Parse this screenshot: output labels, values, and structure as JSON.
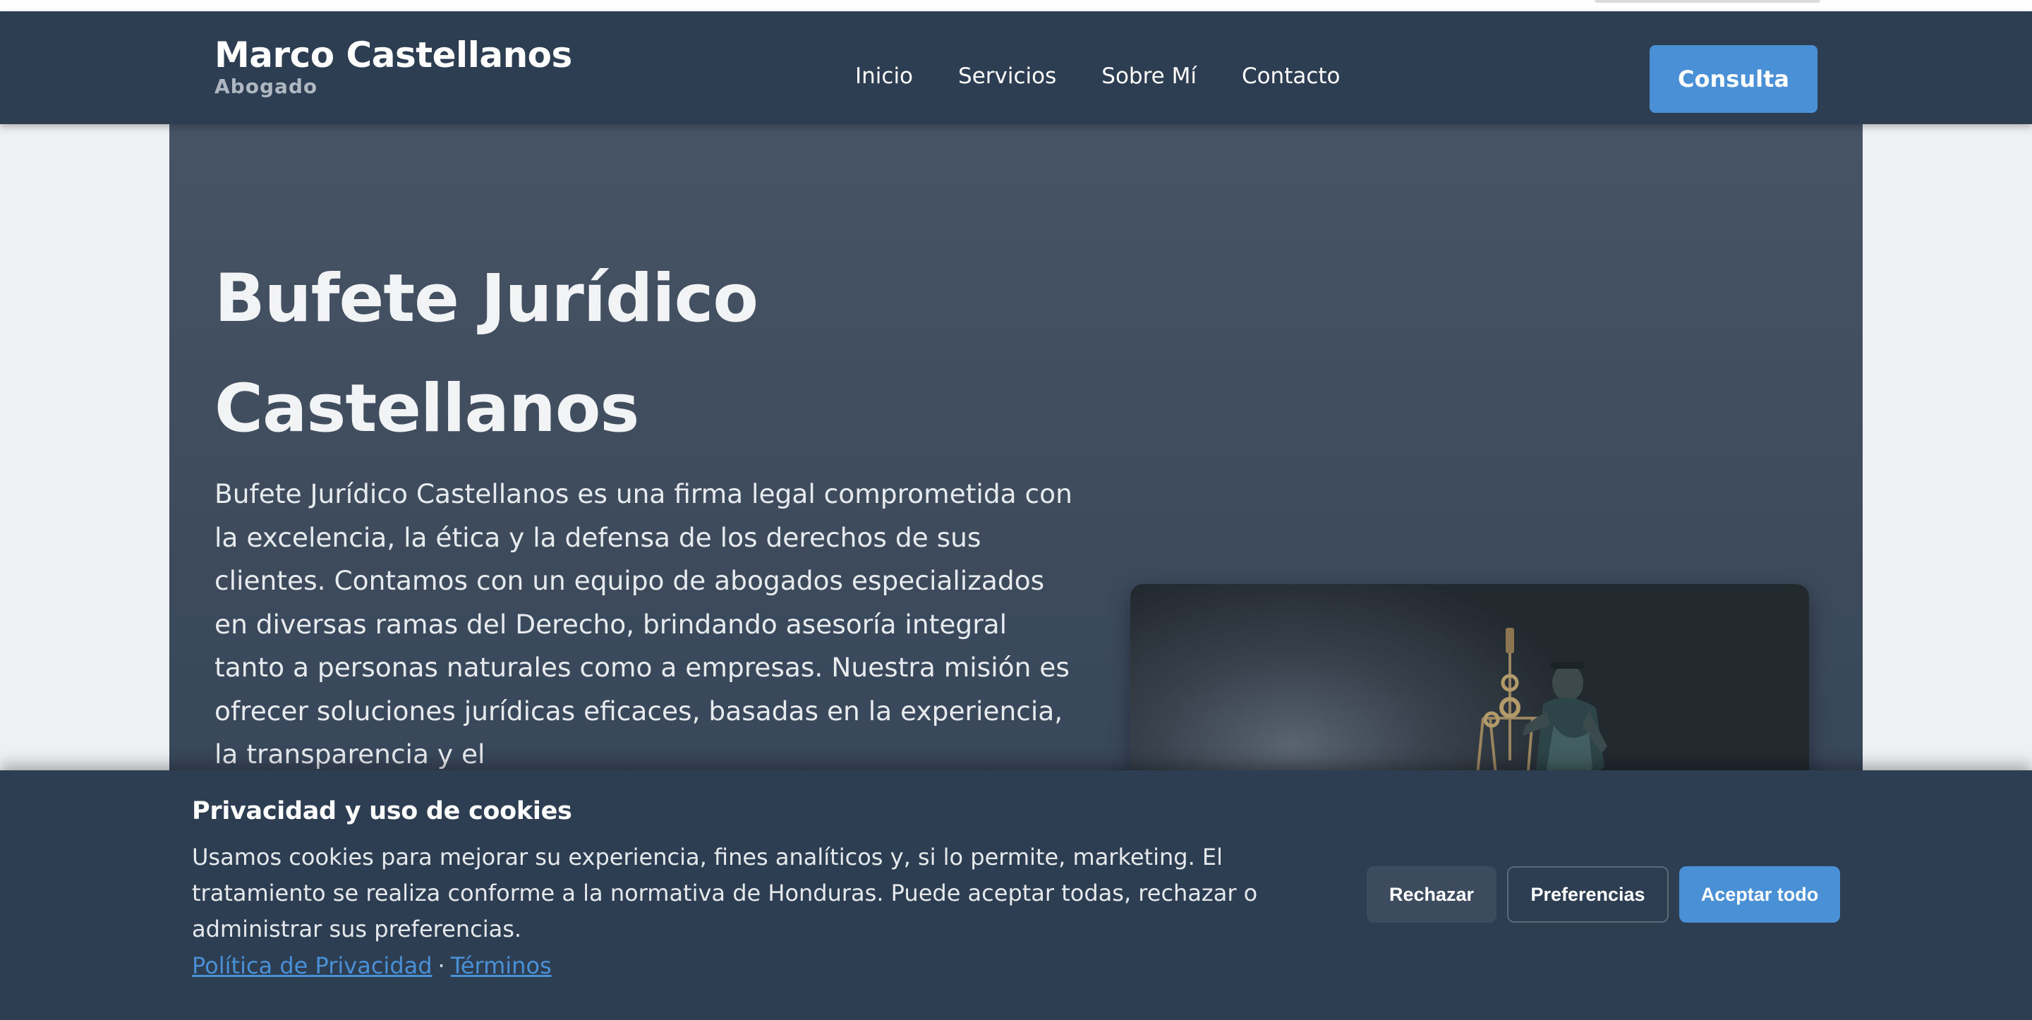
{
  "header": {
    "brand_name": "Marco Castellanos",
    "brand_subtitle": "Abogado",
    "nav": [
      {
        "label": "Inicio"
      },
      {
        "label": "Servicios"
      },
      {
        "label": "Sobre Mí"
      },
      {
        "label": "Contacto"
      }
    ],
    "cta_label": "Consulta"
  },
  "hero": {
    "title": "Bufete Jurídico Castellanos",
    "description": "Bufete Jurídico Castellanos es una firma legal comprometida con la excelencia, la ética y la defensa de los derechos de sus clientes. Contamos con un equipo de abogados especializados en diversas ramas del Derecho, brindando asesoría integral tanto a personas naturales como a empresas. Nuestra misión es ofrecer soluciones jurídicas eficaces, basadas en la experiencia, la transparencia y el",
    "image_icon": "lady-justice-statue"
  },
  "cookie_banner": {
    "title": "Privacidad y uso de cookies",
    "text": "Usamos cookies para mejorar su experiencia, fines analíticos y, si lo permite, marketing. El tratamiento se realiza conforme a la normativa de Honduras. Puede aceptar todas, rechazar o administrar sus preferencias.",
    "privacy_link": "Política de Privacidad",
    "separator": "·",
    "terms_link": "Términos",
    "reject_label": "Rechazar",
    "preferences_label": "Preferencias",
    "accept_label": "Aceptar todo"
  },
  "colors": {
    "navbar": "#2e3e52",
    "accent": "#4a90d6",
    "hero_bg": "#3c4a5c",
    "page_bg": "#eef0f1"
  }
}
